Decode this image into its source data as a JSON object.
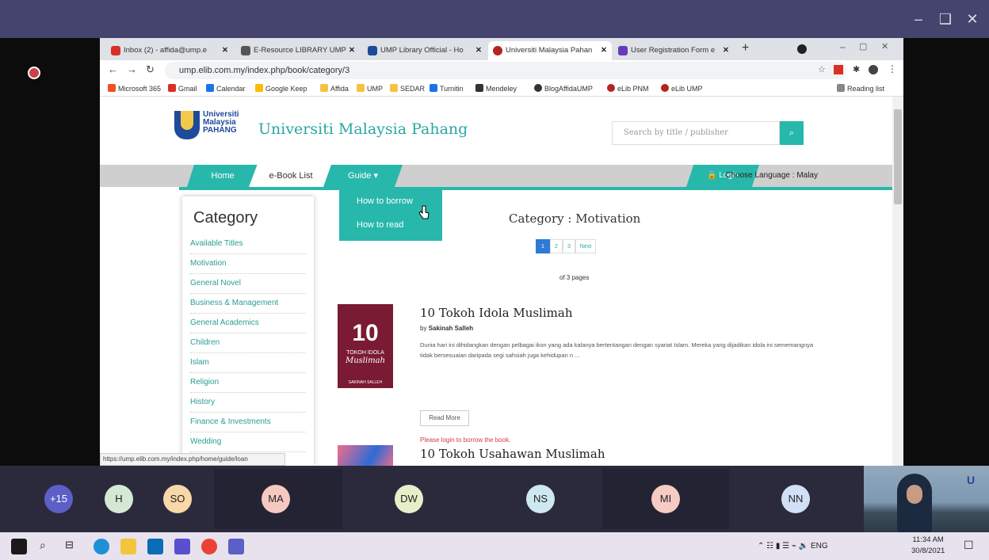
{
  "window_controls": {
    "minimize": "–",
    "restore": "❑",
    "close": "✕"
  },
  "tabs": [
    {
      "label": "Inbox (2) - affida@ump.e",
      "icon_color": "#d93025"
    },
    {
      "label": "E-Resource LIBRARY UMP",
      "icon_color": "#555"
    },
    {
      "label": "UMP Library Official - Ho",
      "icon_color": "#1e4a9a"
    },
    {
      "label": "Universiti Malaysia Pahan",
      "icon_color": "#b3261e"
    },
    {
      "label": "User Registration Form e",
      "icon_color": "#673ab7"
    }
  ],
  "url": "ump.elib.com.my/index.php/book/category/3",
  "bookmarks": [
    {
      "label": "Microsoft 365",
      "color": "#f25022"
    },
    {
      "label": "Gmail",
      "color": "#d93025"
    },
    {
      "label": "Calendar",
      "color": "#1a73e8"
    },
    {
      "label": "Google Keep",
      "color": "#fbbc04"
    },
    {
      "label": "Affida",
      "color": "#f6c243"
    },
    {
      "label": "UMP",
      "color": "#f6c243"
    },
    {
      "label": "SEDAR",
      "color": "#f6c243"
    },
    {
      "label": "Turnitin",
      "color": "#1a73e8"
    },
    {
      "label": "Mendeley",
      "color": "#333"
    },
    {
      "label": "BlogAffidaUMP",
      "color": "#333"
    },
    {
      "label": "eLib PNM",
      "color": "#b3261e"
    },
    {
      "label": "eLib UMP",
      "color": "#b3261e"
    }
  ],
  "reading_list": "Reading list",
  "site": {
    "logo_lines": [
      "Universiti",
      "Malaysia",
      "PAHANG"
    ],
    "title": "Universiti Malaysia Pahang",
    "search_placeholder": "Search by title / publisher",
    "search_icon": "🔍"
  },
  "nav": {
    "home": "Home",
    "ebook": "e-Book List",
    "guide": "Guide ▾",
    "login": "🔒 Login",
    "language": "Choose Language : Malay"
  },
  "dropdown": {
    "borrow": "How to borrow",
    "read": "How to read"
  },
  "sidebar": {
    "title": "Category",
    "items": [
      "Available Titles",
      "Motivation",
      "General Novel",
      "Business & Management",
      "General Academics",
      "Children",
      "Islam",
      "Religion",
      "History",
      "Finance & Investments",
      "Wedding"
    ]
  },
  "status_url": "https://ump.elib.com.my/index.php/home/guide/loan",
  "main": {
    "category_title": "Category : Motivation",
    "pages": [
      "1",
      "2",
      "3",
      "Next"
    ],
    "pages_of": "of 3 pages",
    "books": [
      {
        "title": "10 Tokoh Idola Muslimah",
        "author_prefix": "by",
        "author": "Sakinah Salleh",
        "description": "Dunia hari ini dihidangkan dengan pelbagai ikon yang ada kalanya bertentangan dengan syariat Islam. Mereka yang dijadikan idola ini sememangnya tidak bersesuaian daripada segi sahsiah juga kehidupan n ...",
        "cover_number": "10",
        "cover_text": "TOKOH IDOLA",
        "cover_script": "Muslimah",
        "cover_author": "SAKINAH SALLEH",
        "read_more": "Read More",
        "login_note": "Please login to borrow the book."
      },
      {
        "title": "10 Tokoh Usahawan Muslimah"
      }
    ]
  },
  "participants": [
    {
      "initials": "+15",
      "color": "#5b5fc7"
    },
    {
      "initials": "H",
      "color": "#d5e8d4"
    },
    {
      "initials": "SO",
      "color": "#f8d7a8"
    },
    {
      "initials": "MA",
      "color": "#f6c9c0"
    },
    {
      "initials": "DW",
      "color": "#e6efc9"
    },
    {
      "initials": "NS",
      "color": "#cde9ef"
    },
    {
      "initials": "MI",
      "color": "#f5cbc4"
    },
    {
      "initials": "NN",
      "color": "#d2e0f5"
    }
  ],
  "video_logo": "U",
  "taskbar": {
    "time": "11:34 AM",
    "date": "30/8/2021",
    "lang": "ENG",
    "tray": "⌃ ☷ ▮ ☰ ⌁ 🔉"
  }
}
